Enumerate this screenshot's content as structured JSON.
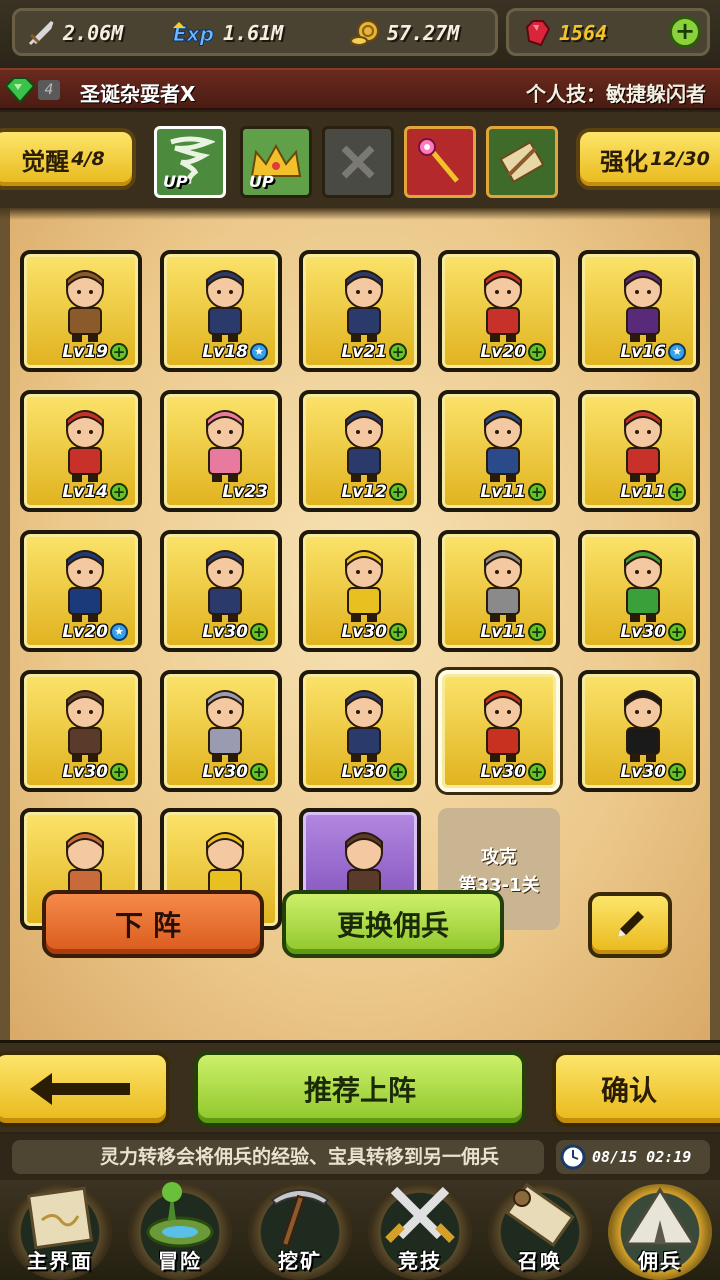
{
  "resources": {
    "attack": "2.06M",
    "exp": "1.61M",
    "gold": "57.27M",
    "gems": "1564"
  },
  "hero_title": {
    "badge_num": "4",
    "name": "圣诞杂耍者X",
    "skill": "个人技：敏捷躲闪者"
  },
  "awakening": {
    "awaken_label": "觉醒",
    "awaken_count": "4/8",
    "enhance_label": "强化",
    "enhance_count": "12/30",
    "up_label": "UP"
  },
  "roster": [
    {
      "level": "Lv19",
      "badge": "plus"
    },
    {
      "level": "Lv18",
      "badge": "star"
    },
    {
      "level": "Lv21",
      "badge": "plus"
    },
    {
      "level": "Lv20",
      "badge": "plus"
    },
    {
      "level": "Lv16",
      "badge": "star"
    },
    {
      "level": "Lv14",
      "badge": "plus"
    },
    {
      "level": "Lv23",
      "badge": "none"
    },
    {
      "level": "Lv12",
      "badge": "plus"
    },
    {
      "level": "Lv11",
      "badge": "plus"
    },
    {
      "level": "Lv11",
      "badge": "plus"
    },
    {
      "level": "Lv20",
      "badge": "star"
    },
    {
      "level": "Lv30",
      "badge": "plus"
    },
    {
      "level": "Lv30",
      "badge": "plus"
    },
    {
      "level": "Lv11",
      "badge": "plus"
    },
    {
      "level": "Lv30",
      "badge": "plus"
    },
    {
      "level": "Lv30",
      "badge": "plus"
    },
    {
      "level": "Lv30",
      "badge": "plus"
    },
    {
      "level": "Lv30",
      "badge": "plus"
    },
    {
      "level": "Lv30",
      "badge": "plus"
    },
    {
      "level": "Lv30",
      "badge": "plus"
    }
  ],
  "locked_slot": {
    "line1": "攻克",
    "line2": "第33-1关"
  },
  "popup": {
    "remove_label": "下阵",
    "replace_label": "更换佣兵"
  },
  "actions": {
    "recommend_label": "推荐上阵",
    "confirm_label": "确认"
  },
  "tip": {
    "text": "灵力转移会将佣兵的经验、宝具转移到另一佣兵",
    "time": "08/15 02:19"
  },
  "nav": [
    {
      "label": "主界面",
      "icon": "map-scroll-icon"
    },
    {
      "label": "冒险",
      "icon": "island-icon"
    },
    {
      "label": "挖矿",
      "icon": "pickaxe-icon"
    },
    {
      "label": "竞技",
      "icon": "crossed-swords-icon"
    },
    {
      "label": "召唤",
      "icon": "summon-scroll-icon"
    },
    {
      "label": "佣兵",
      "icon": "tent-icon"
    }
  ],
  "colors": {
    "gold_panel": "#e8b81a",
    "green_button": "#8ec62a",
    "orange_button": "#d95a1c",
    "parchment": "#f7e2b4",
    "title_red": "#6b2a1d"
  }
}
